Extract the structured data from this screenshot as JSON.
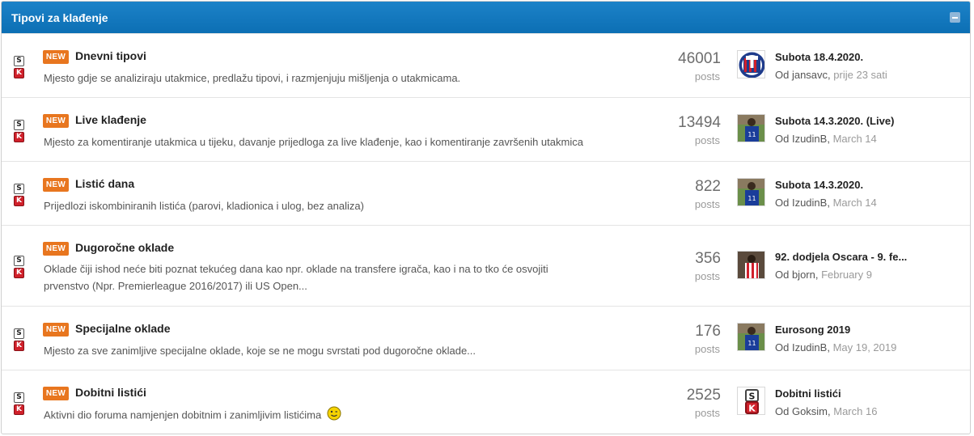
{
  "panel": {
    "title": "Tipovi za klađenje",
    "header_color": "#0f75bd",
    "collapse_icon": "minus-icon"
  },
  "forums": [
    {
      "title": "Dnevni tipovi",
      "badge": "NEW",
      "description": "Mjesto gdje se analiziraju utakmice, predlažu tipovi, i razmjenjuju mišljenja o utakmicama.",
      "count": "46001",
      "count_label": "posts",
      "last_title": "Subota 18.4.2020.",
      "last_by": "Od jansavc,",
      "last_date": "prije 23 sati",
      "avatar": "club-crest-avatar"
    },
    {
      "title": "Live klađenje",
      "badge": "NEW",
      "description": "Mjesto za komentiranje utakmica u tijeku, davanje prijedloga za live klađenje, kao i komentiranje završenih utakmica",
      "count": "13494",
      "count_label": "posts",
      "last_title": "Subota 14.3.2020. (Live)",
      "last_by": "Od IzudinB,",
      "last_date": "March 14",
      "avatar": "player-photo-avatar"
    },
    {
      "title": "Listić dana",
      "badge": "NEW",
      "description": "Prijedlozi iskombiniranih listića (parovi, kladionica i ulog, bez analiza)",
      "count": "822",
      "count_label": "posts",
      "last_title": "Subota 14.3.2020.",
      "last_by": "Od IzudinB,",
      "last_date": "March 14",
      "avatar": "player-photo-avatar"
    },
    {
      "title": "Dugoročne oklade",
      "badge": "NEW",
      "description_lines": [
        "Oklade čiji ishod neće biti poznat tekućeg dana kao npr. oklade na transfere igrača, kao i na to tko će osvojiti",
        "prvenstvo (Npr. Premierleague 2016/2017) ili US Open..."
      ],
      "count": "356",
      "count_label": "posts",
      "last_title": "92. dodjela Oscara - 9. fe...",
      "last_by": "Od bjorn,",
      "last_date": "February 9",
      "avatar": "player-red-white-avatar"
    },
    {
      "title": "Specijalne oklade",
      "badge": "NEW",
      "description": "Mjesto za sve zanimljive specijalne oklade, koje se ne mogu svrstati pod dugoročne oklade...",
      "count": "176",
      "count_label": "posts",
      "last_title": "Eurosong 2019",
      "last_by": "Od IzudinB,",
      "last_date": "May 19, 2019",
      "avatar": "player-photo-avatar"
    },
    {
      "title": "Dobitni listići",
      "badge": "NEW",
      "description": "Aktivni dio foruma namjenjen dobitnim i zanimljivim listićima",
      "count": "2525",
      "count_label": "posts",
      "last_title": "Dobitni listići",
      "last_by": "Od Goksim,",
      "last_date": "March 16",
      "avatar": "sk-logo-avatar",
      "emoji": "wink-smiley-icon"
    }
  ],
  "forum_icon": {
    "top": "S",
    "bottom": "K",
    "name": "sk-forum-icon"
  },
  "badge_color": "#e8761f"
}
